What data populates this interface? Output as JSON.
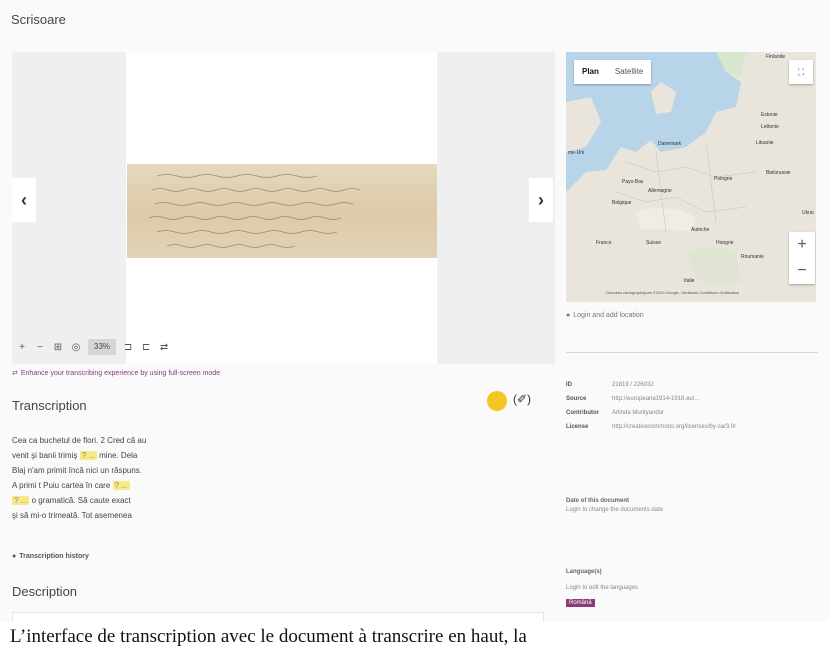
{
  "page": {
    "title": "Scrisoare"
  },
  "viewer": {
    "toolbar": {
      "zoom_in": "+",
      "zoom_out": "−",
      "fit": "⊞",
      "reset": "◎",
      "zoom_level": "33%",
      "rotate_left": "⊐",
      "rotate_right": "⊏",
      "flip": "⇄"
    },
    "prev_label": "‹",
    "next_label": "›"
  },
  "enhance": {
    "icon": "⇄",
    "text": "Enhance your transcribing experience by using full-screen mode"
  },
  "transcription": {
    "title": "Transcription",
    "edit_icon": "(✐)",
    "unclear_mark": "? ...",
    "lines": [
      {
        "before": "Cea ca buchetul de flori. 2 Cred că au",
        "unclear": "",
        "after": ""
      },
      {
        "before": "venit şi banii trimiş ",
        "unclear": "? ...",
        "after": " mine. Dela"
      },
      {
        "before": "Blaj n'am primit încă nici un răspuns.",
        "unclear": "",
        "after": ""
      },
      {
        "before": "A primi t Puiu cartea în care ",
        "unclear": "? ...",
        "after": ""
      },
      {
        "before": "",
        "unclear": "? ...",
        "after": "  o gramatică. Să caute exact"
      },
      {
        "before": "şi să mi-o trimeată. Tot asemenea",
        "unclear": "",
        "after": ""
      }
    ],
    "history": "Transcription history"
  },
  "description": {
    "title": "Description"
  },
  "map": {
    "tabs": [
      "Plan",
      "Satellite"
    ],
    "fullscreen": "⛶",
    "zoom_in": "+",
    "zoom_out": "−",
    "labels": [
      "Finlande",
      "Estonie",
      "Lettonie",
      "Lituanie",
      "Danemark",
      "me-Uni",
      "Pays-Bas",
      "Allemagne",
      "Belgique",
      "Pologne",
      "Bielorussie",
      "Ukrai",
      "France",
      "Suisse",
      "Autriche",
      "Hongrie",
      "Roumanie",
      "Italie"
    ],
    "footer": "Données cartographiques ©2019 Google, GeoBasis   Conditions d'utilisation",
    "login_location": "Login and add location"
  },
  "metadata": {
    "rows": [
      {
        "key": "ID",
        "value": "21819 / 226032"
      },
      {
        "key": "Source",
        "value": "http://europeana1914-1918.eu/..."
      },
      {
        "key": "Contributor",
        "value": "Arlinda Muntyandor"
      },
      {
        "key": "License",
        "value": "http://creativecommons.org/licenses/by-sa/3.0/"
      }
    ]
  },
  "date": {
    "head": "Date of this document",
    "note": "Login to change the documents date"
  },
  "language": {
    "head": "Language(s)",
    "note": "Login to edit the languages",
    "badge": "Română"
  },
  "caption": "L’interface de transcription avec le document à transcrire en haut, la"
}
